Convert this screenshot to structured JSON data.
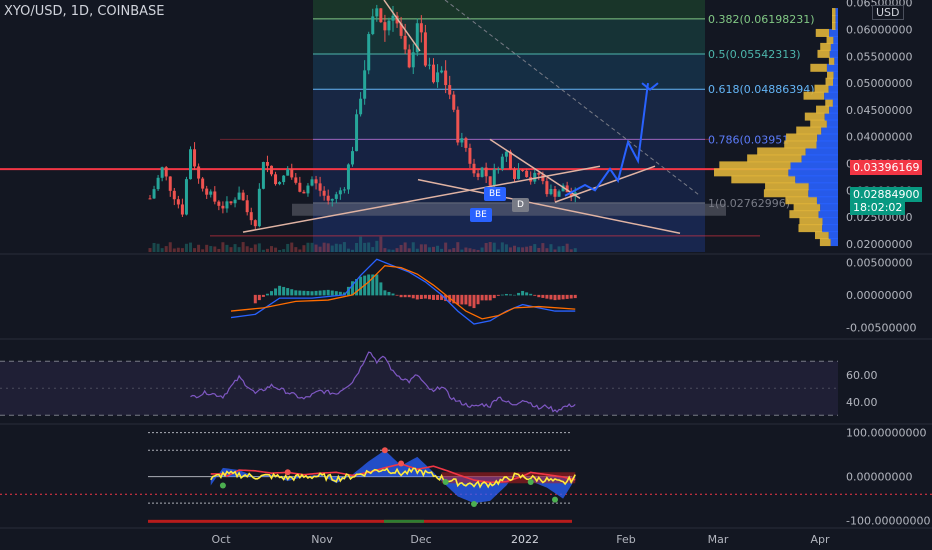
{
  "header": {
    "title": "XYO/USD, 1D, COINBASE",
    "currency_button": "USD"
  },
  "colors": {
    "bg": "#131722",
    "up": "#26a69a",
    "down": "#ef5350",
    "accent": "#2962ff"
  },
  "price_panel": {
    "fib_levels": [
      {
        "label": "0.382(0.06198231)",
        "value": 0.06198231,
        "color": "#81c784"
      },
      {
        "label": "0.5(0.05542313)",
        "value": 0.05542313,
        "color": "#4db6ac"
      },
      {
        "label": "0.618(0.04886394)",
        "value": 0.04886394,
        "color": "#64b5f6"
      },
      {
        "label": "0.786(0.03951",
        "value": 0.03951,
        "color": "#5c7cfa"
      },
      {
        "label": "1(0.02762996)",
        "value": 0.02762996,
        "color": "#787b86"
      }
    ],
    "current_price": "0.02884900",
    "countdown": "18:02:02",
    "resistance_price": "0.03396169",
    "markers": [
      "BE",
      "BE",
      "D"
    ]
  },
  "chart_data": [
    {
      "type": "candlestick",
      "title": "XYO/USD, 1D, COINBASE",
      "x_ticks": [
        "Oct",
        "Nov",
        "Dec",
        "2022",
        "Feb",
        "Mar",
        "Apr"
      ],
      "y_ticks": [
        "0.06500000",
        "0.06000000",
        "0.05500000",
        "0.05000000",
        "0.04500000",
        "0.04000000",
        "0.03500000",
        "0.03000000",
        "0.02500000",
        "0.02000000"
      ],
      "ylim": [
        0.0185,
        0.0655
      ],
      "close_path": [
        [
          0,
          0.0285
        ],
        [
          3,
          0.034
        ],
        [
          5,
          0.0305
        ],
        [
          8,
          0.026
        ],
        [
          10,
          0.038
        ],
        [
          12,
          0.032
        ],
        [
          14,
          0.03
        ],
        [
          16,
          0.028
        ],
        [
          18,
          0.027
        ],
        [
          20,
          0.0275
        ],
        [
          22,
          0.03
        ],
        [
          24,
          0.026
        ],
        [
          26,
          0.024
        ],
        [
          28,
          0.036
        ],
        [
          30,
          0.033
        ],
        [
          32,
          0.031
        ],
        [
          34,
          0.034
        ],
        [
          36,
          0.031
        ],
        [
          38,
          0.03
        ],
        [
          40,
          0.032
        ],
        [
          42,
          0.03
        ],
        [
          44,
          0.028
        ],
        [
          46,
          0.029
        ],
        [
          48,
          0.031
        ],
        [
          50,
          0.038
        ],
        [
          52,
          0.048
        ],
        [
          54,
          0.058
        ],
        [
          56,
          0.064
        ],
        [
          58,
          0.06
        ],
        [
          60,
          0.064
        ],
        [
          62,
          0.058
        ],
        [
          64,
          0.052
        ],
        [
          66,
          0.062
        ],
        [
          68,
          0.054
        ],
        [
          70,
          0.05
        ],
        [
          72,
          0.052
        ],
        [
          74,
          0.048
        ],
        [
          76,
          0.04
        ],
        [
          78,
          0.038
        ],
        [
          80,
          0.033
        ],
        [
          82,
          0.034
        ],
        [
          84,
          0.0315
        ],
        [
          86,
          0.035
        ],
        [
          88,
          0.037
        ],
        [
          90,
          0.033
        ],
        [
          92,
          0.0345
        ],
        [
          94,
          0.032
        ],
        [
          96,
          0.033
        ],
        [
          98,
          0.03
        ],
        [
          100,
          0.0295
        ],
        [
          102,
          0.0305
        ],
        [
          104,
          0.029
        ],
        [
          105,
          0.0288
        ]
      ],
      "volume_profile_max_price": 0.034
    },
    {
      "type": "line",
      "name": "MACD",
      "y_ticks": [
        "0.00500000",
        "0.00000000",
        "-0.00500000"
      ],
      "ylim": [
        -0.0065,
        0.006
      ],
      "macd": [
        [
          20,
          -0.0035
        ],
        [
          26,
          -0.003
        ],
        [
          32,
          -0.0005
        ],
        [
          40,
          -0.0005
        ],
        [
          48,
          0.0
        ],
        [
          52,
          0.003
        ],
        [
          56,
          0.0055
        ],
        [
          60,
          0.0045
        ],
        [
          64,
          0.0035
        ],
        [
          68,
          0.002
        ],
        [
          72,
          0.0
        ],
        [
          76,
          -0.0025
        ],
        [
          80,
          -0.0045
        ],
        [
          84,
          -0.004
        ],
        [
          88,
          -0.0025
        ],
        [
          92,
          -0.0015
        ],
        [
          96,
          -0.002
        ],
        [
          100,
          -0.0025
        ],
        [
          105,
          -0.0025
        ]
      ],
      "signal": [
        [
          20,
          -0.0025
        ],
        [
          28,
          -0.002
        ],
        [
          36,
          -0.001
        ],
        [
          44,
          -0.0008
        ],
        [
          50,
          0.0
        ],
        [
          54,
          0.002
        ],
        [
          58,
          0.0045
        ],
        [
          62,
          0.0042
        ],
        [
          66,
          0.0032
        ],
        [
          70,
          0.0015
        ],
        [
          74,
          -0.0005
        ],
        [
          78,
          -0.0025
        ],
        [
          82,
          -0.0037
        ],
        [
          86,
          -0.0032
        ],
        [
          90,
          -0.002
        ],
        [
          96,
          -0.0018
        ],
        [
          105,
          -0.0022
        ]
      ]
    },
    {
      "type": "line",
      "name": "RSI",
      "y_ticks": [
        "60.00",
        "40.00"
      ],
      "ylim": [
        25,
        85
      ],
      "bands": [
        70,
        30
      ],
      "rsi": [
        [
          10,
          43
        ],
        [
          14,
          47
        ],
        [
          18,
          44
        ],
        [
          22,
          58
        ],
        [
          26,
          46
        ],
        [
          30,
          52
        ],
        [
          34,
          47
        ],
        [
          38,
          42
        ],
        [
          42,
          48
        ],
        [
          46,
          46
        ],
        [
          50,
          55
        ],
        [
          52,
          65
        ],
        [
          54,
          78
        ],
        [
          56,
          70
        ],
        [
          58,
          73
        ],
        [
          60,
          62
        ],
        [
          62,
          58
        ],
        [
          64,
          55
        ],
        [
          66,
          60
        ],
        [
          68,
          52
        ],
        [
          70,
          47
        ],
        [
          72,
          52
        ],
        [
          74,
          44
        ],
        [
          76,
          40
        ],
        [
          78,
          38
        ],
        [
          80,
          36
        ],
        [
          82,
          38
        ],
        [
          84,
          37
        ],
        [
          86,
          44
        ],
        [
          88,
          40
        ],
        [
          90,
          37
        ],
        [
          92,
          42
        ],
        [
          94,
          39
        ],
        [
          96,
          35
        ],
        [
          98,
          37
        ],
        [
          100,
          33
        ],
        [
          102,
          36
        ],
        [
          105,
          38
        ]
      ]
    },
    {
      "type": "area",
      "name": "Oscillator",
      "y_ticks": [
        "100.00000000",
        "0.00000000",
        "-100.00000000"
      ],
      "ylim": [
        -112,
        115
      ],
      "wave": [
        [
          15,
          -20
        ],
        [
          18,
          20
        ],
        [
          22,
          15
        ],
        [
          26,
          0
        ],
        [
          30,
          5
        ],
        [
          34,
          -10
        ],
        [
          38,
          0
        ],
        [
          42,
          5
        ],
        [
          46,
          -15
        ],
        [
          50,
          5
        ],
        [
          54,
          35
        ],
        [
          58,
          60
        ],
        [
          62,
          25
        ],
        [
          66,
          45
        ],
        [
          70,
          10
        ],
        [
          72,
          -10
        ],
        [
          76,
          -45
        ],
        [
          80,
          -60
        ],
        [
          84,
          -55
        ],
        [
          88,
          -20
        ],
        [
          90,
          5
        ],
        [
          94,
          -10
        ],
        [
          98,
          -25
        ],
        [
          102,
          -50
        ],
        [
          105,
          -5
        ]
      ]
    }
  ]
}
